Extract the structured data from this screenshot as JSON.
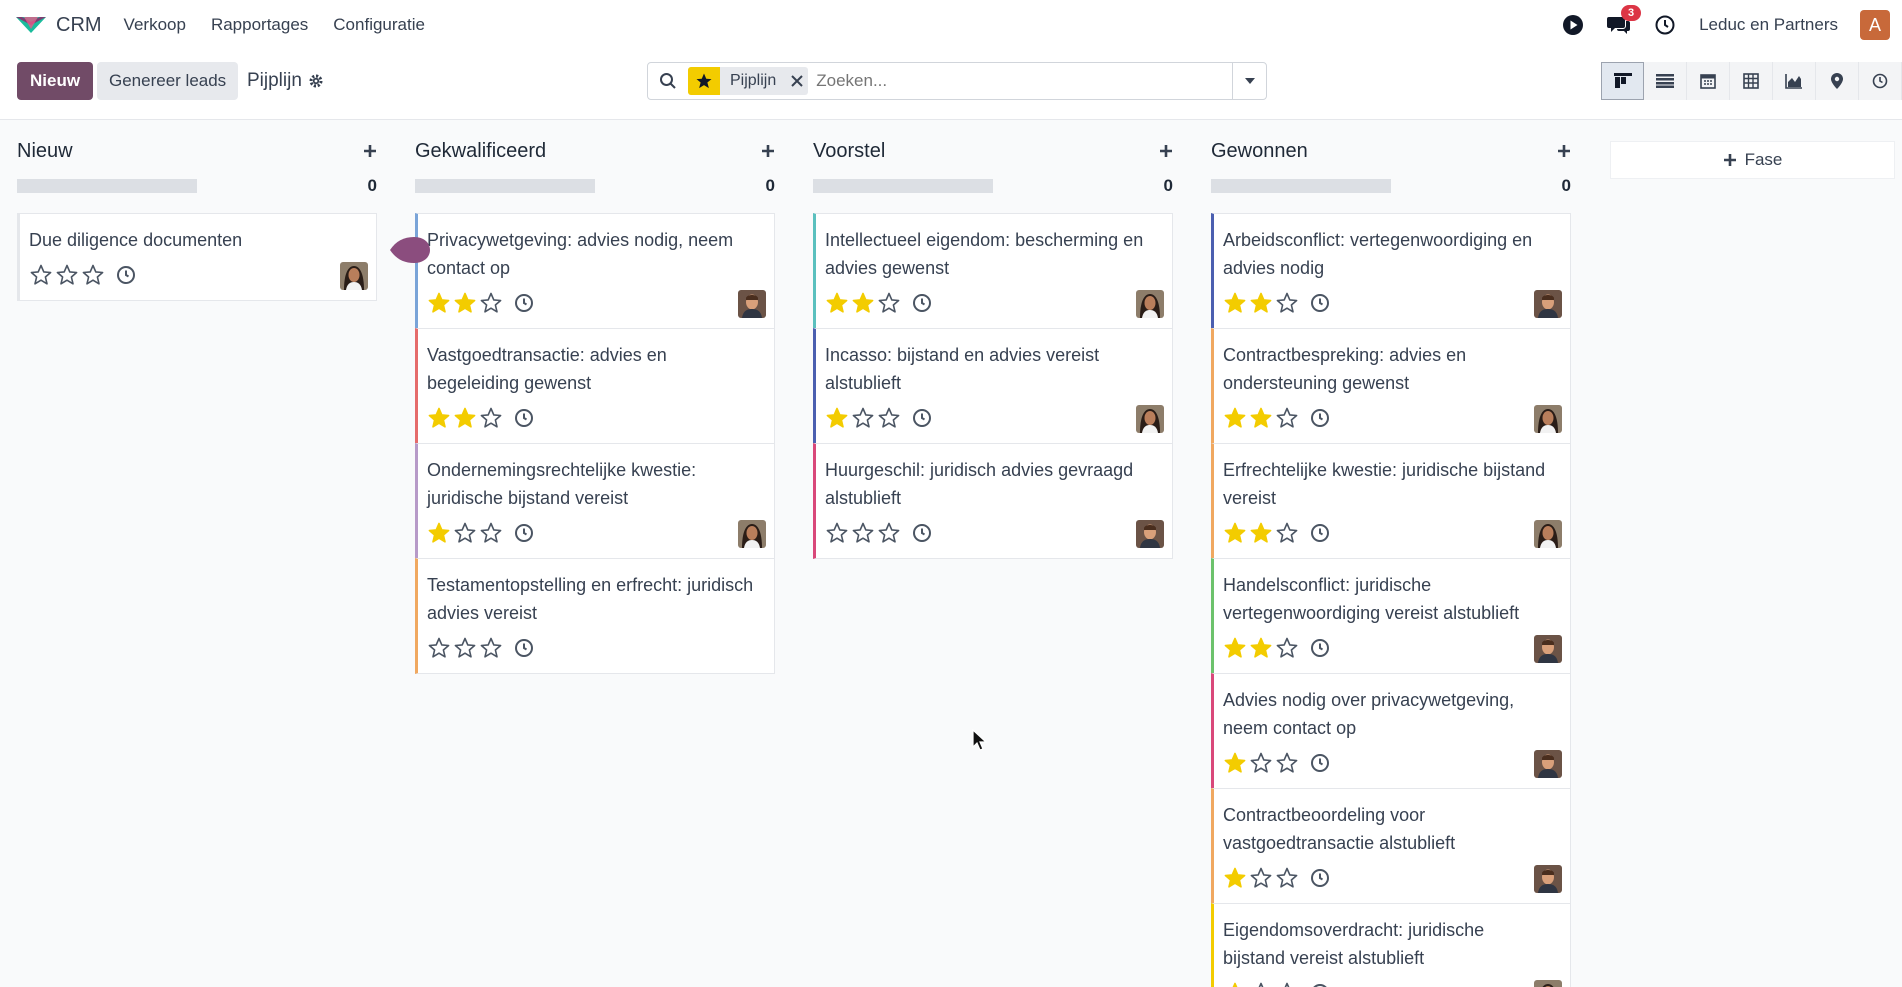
{
  "app": {
    "name": "CRM"
  },
  "nav": {
    "items": [
      "Verkoop",
      "Rapportages",
      "Configuratie"
    ],
    "notifications": "3",
    "company": "Leduc en Partners",
    "user_initial": "A"
  },
  "control": {
    "new_label": "Nieuw",
    "generate_label": "Genereer leads",
    "breadcrumb": "Pijplijn"
  },
  "search": {
    "facet": "Pijplijn",
    "placeholder": "Zoeken..."
  },
  "kanban": {
    "add_stage_label": "Fase",
    "columns": [
      {
        "title": "Nieuw",
        "count": "0",
        "color": "#e5e7eb",
        "cards": [
          {
            "title": "Due diligence documenten",
            "stars": 0,
            "border": "#e5e7eb",
            "avatar": "woman"
          }
        ]
      },
      {
        "title": "Gekwalificeerd",
        "count": "0",
        "cards": [
          {
            "title": "Privacywetgeving: advies nodig, neem contact op",
            "stars": 2,
            "border": "#7aa4d8",
            "avatar": "man"
          },
          {
            "title": "Vastgoedtransactie: advies en begeleiding gewenst",
            "stars": 2,
            "border": "#e56b6b",
            "avatar": ""
          },
          {
            "title": "Ondernemingsrechtelijke kwestie: juridische bijstand vereist",
            "stars": 1,
            "border": "#b79ac8",
            "avatar": "woman"
          },
          {
            "title": "Testamentopstelling en erfrecht: juridisch advies vereist",
            "stars": 0,
            "border": "#f0a860",
            "avatar": ""
          }
        ]
      },
      {
        "title": "Voorstel",
        "count": "0",
        "cards": [
          {
            "title": "Intellectueel eigendom: bescherming en advies gewenst",
            "stars": 2,
            "border": "#5bc0be",
            "avatar": "woman"
          },
          {
            "title": "Incasso: bijstand en advies vereist alstublieft",
            "stars": 1,
            "border": "#4b5fb0",
            "avatar": "woman"
          },
          {
            "title": "Huurgeschil: juridisch advies gevraagd alstublieft",
            "stars": 0,
            "border": "#d9487a",
            "avatar": "man"
          }
        ]
      },
      {
        "title": "Gewonnen",
        "count": "0",
        "cards": [
          {
            "title": "Arbeidsconflict: vertegenwoordiging en advies nodig",
            "stars": 2,
            "border": "#4b5fb0",
            "avatar": "man"
          },
          {
            "title": "Contractbespreking: advies en ondersteuning gewenst",
            "stars": 2,
            "border": "#f0a860",
            "avatar": "woman"
          },
          {
            "title": "Erfrechtelijke kwestie: juridische bijstand vereist",
            "stars": 2,
            "border": "#f0a860",
            "avatar": "woman"
          },
          {
            "title": "Handelsconflict: juridische vertegenwoordiging vereist alstublieft",
            "stars": 2,
            "border": "#6cc26c",
            "avatar": "man"
          },
          {
            "title": "Advies nodig over privacywetgeving, neem contact op",
            "stars": 1,
            "border": "#d9487a",
            "avatar": "man"
          },
          {
            "title": "Contractbeoordeling voor vastgoedtransactie alstublieft",
            "stars": 1,
            "border": "#f0a860",
            "avatar": "man"
          },
          {
            "title": "Eigendomsoverdracht: juridische bijstand vereist alstublieft",
            "stars": 1,
            "border": "#f3cc00",
            "avatar": "woman"
          }
        ]
      }
    ]
  },
  "colors": {
    "primary": "#714b67",
    "star": "#f3cc00"
  }
}
